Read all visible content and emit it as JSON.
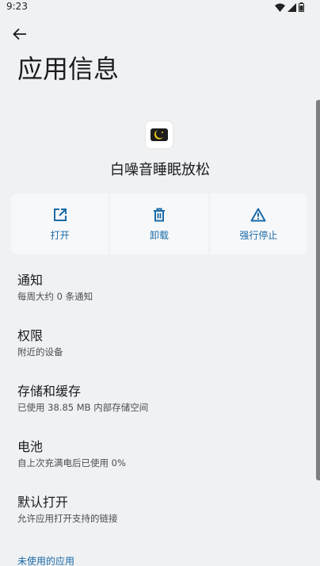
{
  "status_bar": {
    "time": "9:23",
    "icons": [
      "wifi-icon",
      "signal-icon",
      "battery-icon"
    ]
  },
  "header": {
    "back_icon": "arrow-left-icon",
    "title": "应用信息"
  },
  "app": {
    "name": "白噪音睡眠放松",
    "icon": "moon-app-icon"
  },
  "actions": [
    {
      "label": "打开",
      "icon": "open-external-icon"
    },
    {
      "label": "卸载",
      "icon": "trash-icon"
    },
    {
      "label": "强行停止",
      "icon": "warning-icon"
    }
  ],
  "settings": [
    {
      "title": "通知",
      "subtitle": "每周大约 0 条通知"
    },
    {
      "title": "权限",
      "subtitle": "附近的设备"
    },
    {
      "title": "存储和缓存",
      "subtitle": "已使用 38.85 MB 内部存储空间"
    },
    {
      "title": "电池",
      "subtitle": "自上次充满电后已使用 0%"
    },
    {
      "title": "默认打开",
      "subtitle": "允许应用打开支持的链接"
    }
  ],
  "section_unused": "未使用的应用",
  "colors": {
    "accent": "#1a6aa8",
    "background": "#eff1f2",
    "card": "#f7f8f9"
  }
}
